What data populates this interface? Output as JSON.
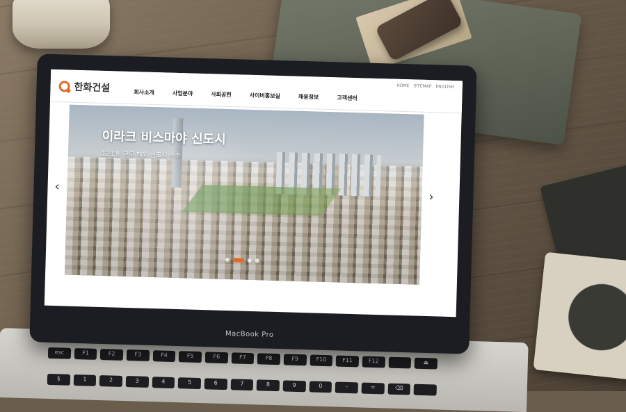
{
  "laptop": {
    "brand_label": "MacBook Pro"
  },
  "site": {
    "logo_text": "한화건설",
    "util_links": [
      "HOME",
      "SITEMAP",
      "ENGLISH"
    ],
    "nav": [
      "회사소개",
      "사업분야",
      "사회공헌",
      "사이버홍보실",
      "채용정보",
      "고객센터"
    ]
  },
  "slider": {
    "title": "이라크 비스마야 신도시",
    "subtitle": "12조원 규모 해외 신도시 수주",
    "prev_icon": "chevron-left-icon",
    "next_icon": "chevron-right-icon",
    "dot_count": 4,
    "active_dot": 1
  },
  "keyboard": {
    "keys": [
      "esc",
      "F1",
      "F2",
      "F3",
      "F4",
      "F5",
      "F6",
      "F7",
      "F8",
      "F9",
      "F10",
      "F11",
      "F12",
      "",
      "⏏",
      "§",
      "1",
      "2",
      "3",
      "4",
      "5",
      "6",
      "7",
      "8",
      "9",
      "0",
      "-",
      "=",
      "⌫",
      ""
    ]
  },
  "colors": {
    "accent": "#e26b24"
  }
}
